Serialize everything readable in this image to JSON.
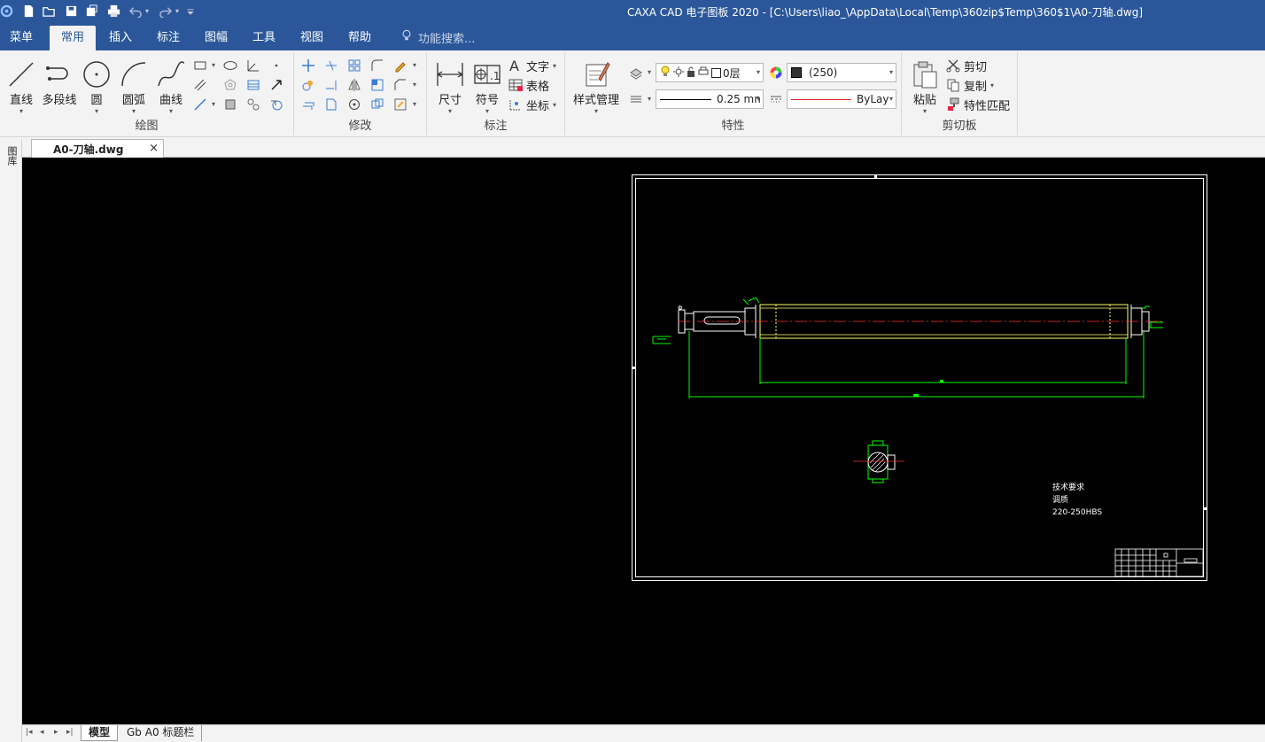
{
  "window": {
    "title": "CAXA CAD 电子图板 2020 - [C:\\Users\\liao_\\AppData\\Local\\Temp\\360zip$Temp\\360$1\\A0-刀轴.dwg]"
  },
  "quick_access": [
    "app-logo-icon",
    "new-file-icon",
    "open-file-icon",
    "save-icon",
    "save-as-icon",
    "print-icon",
    "undo-icon",
    "redo-icon",
    "customize-icon"
  ],
  "menu": {
    "tabs": [
      {
        "label": "菜单"
      },
      {
        "label": "常用"
      },
      {
        "label": "插入"
      },
      {
        "label": "标注"
      },
      {
        "label": "图幅"
      },
      {
        "label": "工具"
      },
      {
        "label": "视图"
      },
      {
        "label": "帮助"
      }
    ],
    "active": "常用",
    "search_placeholder": "功能搜索..."
  },
  "ribbon": {
    "draw": {
      "group_label": "绘图",
      "line": "直线",
      "polyline": "多段线",
      "circle": "圆",
      "arc": "圆弧",
      "curve": "曲线"
    },
    "modify": {
      "group_label": "修改"
    },
    "annotate": {
      "group_label": "标注",
      "dimension": "尺寸",
      "symbol": "符号",
      "text": "文字",
      "table": "表格",
      "coordinate": "坐标"
    },
    "properties": {
      "group_label": "特性",
      "style_manager": "样式管理",
      "layer": "0层",
      "color": "(250)",
      "line_width": "0.25 mn",
      "line_type": "ByLay"
    },
    "clipboard": {
      "group_label": "剪切板",
      "paste": "粘贴",
      "cut": "剪切",
      "copy": "复制",
      "match_properties": "特性匹配"
    }
  },
  "document": {
    "tab_label": "A0-刀轴.dwg",
    "close": "×",
    "sidebar_label": "图库"
  },
  "drawing": {
    "tech_req_title": "技术要求",
    "tech_req_line1": "调质",
    "tech_req_line2": "220-250HBS"
  },
  "layout_tabs": [
    {
      "label": "模型"
    },
    {
      "label": "Gb A0 标题栏"
    }
  ],
  "colors": {
    "titlebar": "#2b579a",
    "canvas": "#000000",
    "drawing_green": "#00ff00",
    "drawing_yellow": "#ffff66",
    "centerline_red": "#ff0000"
  }
}
